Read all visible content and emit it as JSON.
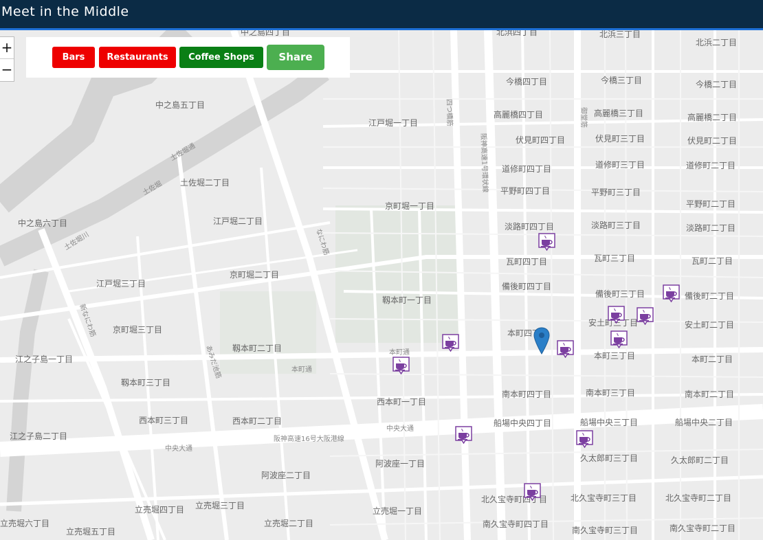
{
  "header": {
    "title": "Meet in the Middle"
  },
  "zoom": {
    "in_label": "+",
    "out_label": "−"
  },
  "toolbar": {
    "bars_label": "Bars",
    "restaurants_label": "Restaurants",
    "coffee_label": "Coffee Shops",
    "share_label": "Share"
  },
  "map_labels": {
    "l01": "中之島四丁目",
    "l02": "北浜四丁目",
    "l03": "北浜三丁目",
    "l04": "北浜二丁目",
    "l05": "中之島五丁目",
    "l06": "今橋四丁目",
    "l07": "今橋三丁目",
    "l08": "今橋二丁目",
    "l09": "江戸堀一丁目",
    "l10": "高麗橋四丁目",
    "l11": "高麗橋三丁目",
    "l12": "高麗橋二丁目",
    "l13": "伏見町四丁目",
    "l14": "伏見町三丁目",
    "l15": "伏見町二丁目",
    "l16": "土佐堀二丁目",
    "l17": "道修町四丁目",
    "l18": "道修町三丁目",
    "l19": "道修町二丁目",
    "l20": "平野町四丁目",
    "l21": "平野町三丁目",
    "l22": "平野町二丁目",
    "l23": "京町堀一丁目",
    "l24": "中之島六丁目",
    "l25": "江戸堀二丁目",
    "l26": "淡路町四丁目",
    "l27": "淡路町三丁目",
    "l28": "淡路町二丁目",
    "l29": "瓦町四丁目",
    "l30": "瓦町三丁目",
    "l31": "瓦町二丁目",
    "l32": "京町堀二丁目",
    "l33": "江戸堀三丁目",
    "l34": "備後町四丁目",
    "l35": "備後町三丁目",
    "l36": "備後町二丁目",
    "l37": "靱本町一丁目",
    "l38": "京町堀三丁目",
    "l39": "安土町三丁目",
    "l40": "安土町二丁目",
    "l41": "本町四丁目",
    "l42": "本町三丁目",
    "l43": "本町二丁目",
    "l44": "靱本町二丁目",
    "l45": "江之子島一丁目",
    "l46": "本町通",
    "l47": "靱本町三丁目",
    "l48": "西本町一丁目",
    "l49": "南本町四丁目",
    "l50": "南本町三丁目",
    "l51": "南本町二丁目",
    "l52": "西本町三丁目",
    "l53": "西本町二丁目",
    "l54": "船場中央四丁目",
    "l55": "船場中央三丁目",
    "l56": "船場中央二丁目",
    "l57": "江之子島二丁目",
    "l58": "中央大通",
    "l59": "阪神高速16号大阪港線",
    "l60": "阿波座一丁目",
    "l61": "久太郎町三丁目",
    "l62": "久太郎町二丁目",
    "l63": "阿波座二丁目",
    "l64": "北久宝寺町四丁目",
    "l65": "北久宝寺町三丁目",
    "l66": "北久宝寺町二丁目",
    "l67": "立売堀四丁目",
    "l68": "立売堀三丁目",
    "l69": "立売堀一丁目",
    "l70": "立売堀二丁目",
    "l71": "立売堀六丁目",
    "l72": "立売堀五丁目",
    "l73": "南久宝寺町四丁目",
    "l74": "南久宝寺町三丁目",
    "l75": "南久宝寺町二丁目",
    "l76": "土佐堀川",
    "l77": "土佐堀通",
    "l78": "本町通",
    "l79": "中央大通",
    "l80": "土佐堀",
    "l81": "新なにわ筋",
    "l82": "あみだ池筋",
    "l83": "なにわ筋",
    "l84": "四つ橋筋",
    "l85": "御堂筋",
    "l86": "阪神高速1号環状線"
  },
  "markers": {
    "coffee_icon": "coffee-cup-icon",
    "coffee_color": "#7b3fa0",
    "pin_color": "#2a7fc8"
  }
}
